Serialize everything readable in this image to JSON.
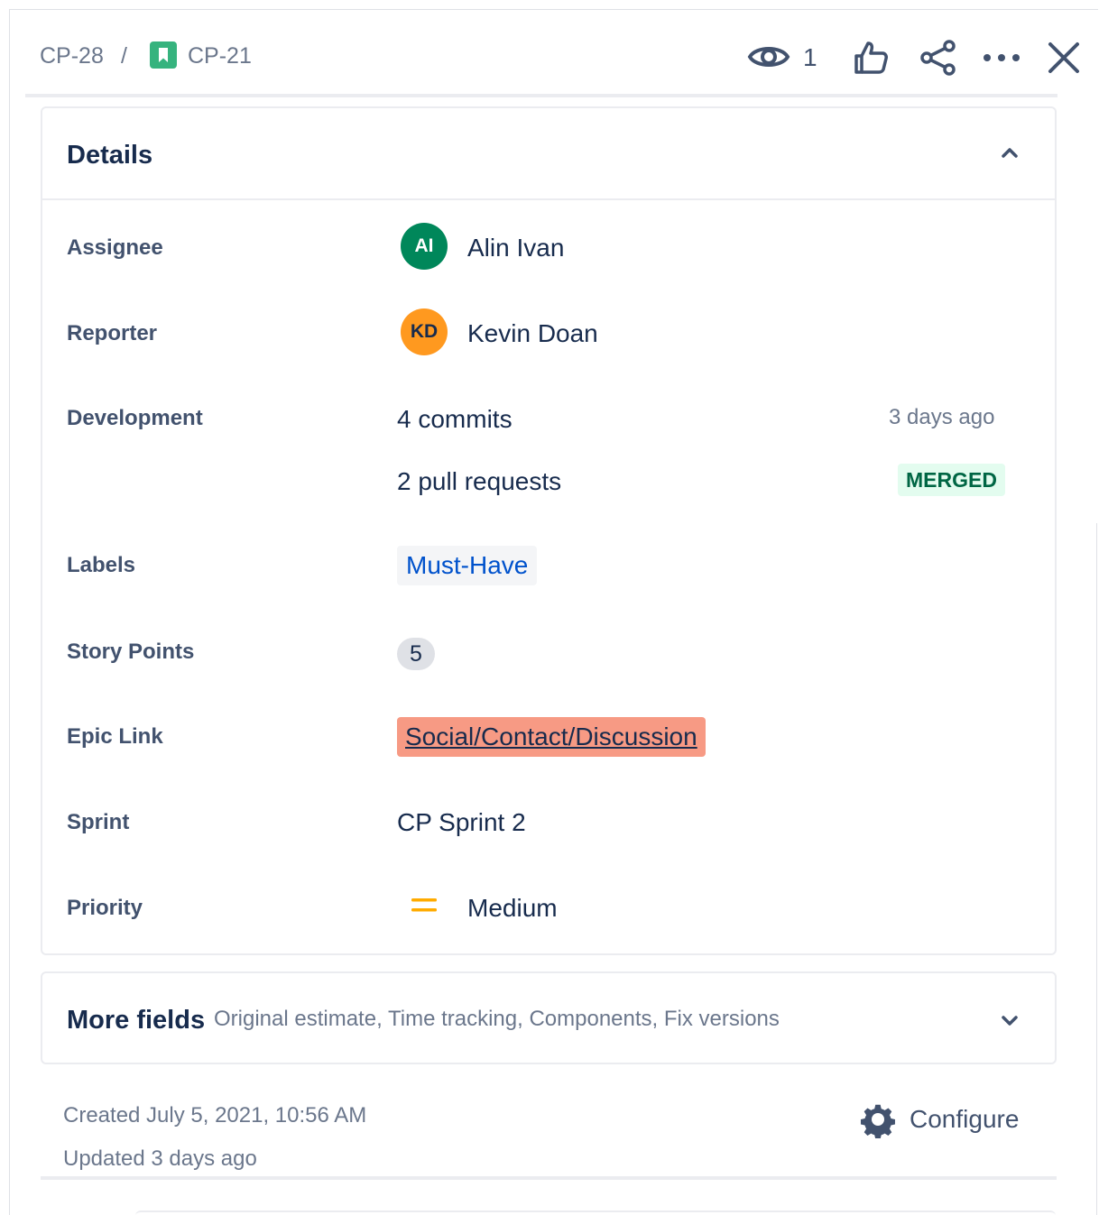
{
  "breadcrumb": {
    "parent": "CP-28",
    "separator": "/",
    "current": "CP-21"
  },
  "header": {
    "watch_count": "1",
    "icons": [
      "eye-icon",
      "thumbs-up-icon",
      "share-icon",
      "more-icon",
      "close-icon"
    ]
  },
  "details": {
    "title": "Details",
    "assignee": {
      "label": "Assignee",
      "initials": "AI",
      "name": "Alin Ivan",
      "color": "#00875a"
    },
    "reporter": {
      "label": "Reporter",
      "initials": "KD",
      "name": "Kevin Doan",
      "color": "#ff991f"
    },
    "development": {
      "label": "Development",
      "commits_count": "4",
      "commits_text": "commits",
      "commits_time": "3 days ago",
      "prs_count": "2",
      "prs_text": "pull requests",
      "prs_status": "MERGED"
    },
    "labels": {
      "label": "Labels",
      "value": "Must-Have"
    },
    "story_points": {
      "label": "Story Points",
      "value": "5"
    },
    "epic_link": {
      "label": "Epic Link",
      "value": "Social/Contact/Discussion",
      "color": "#f79a84"
    },
    "sprint": {
      "label": "Sprint",
      "value": "CP Sprint 2"
    },
    "priority": {
      "label": "Priority",
      "value": "Medium",
      "color": "#ffab00"
    }
  },
  "more_fields": {
    "title": "More fields",
    "subtitle": "Original estimate, Time tracking, Components, Fix versions"
  },
  "footer": {
    "created": "Created July 5, 2021, 10:56 AM",
    "updated": "Updated 3 days ago",
    "configure_label": "Configure"
  }
}
